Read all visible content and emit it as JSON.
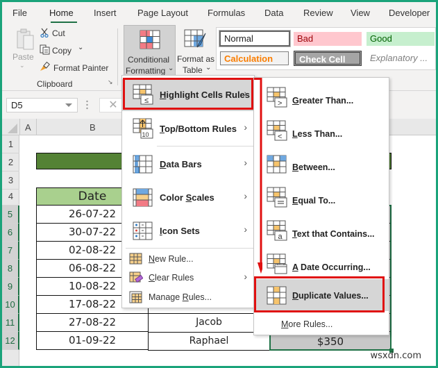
{
  "ribbon_tabs": [
    "File",
    "Home",
    "Insert",
    "Page Layout",
    "Formulas",
    "Data",
    "Review",
    "View",
    "Developer"
  ],
  "active_tab": "Home",
  "clipboard": {
    "paste_label": "Paste",
    "cut_label": "Cut",
    "copy_label": "Copy",
    "format_painter_label": "Format Painter",
    "group_label": "Clipboard"
  },
  "styles": {
    "conditional_formatting_line1": "Conditional",
    "conditional_formatting_line2": "Formatting",
    "format_as_table_line1": "Format as",
    "format_as_table_line2": "Table",
    "cell_styles": [
      {
        "label": "Normal",
        "color": "#222222",
        "bg": "#ffffff"
      },
      {
        "label": "Bad",
        "color": "#9c0006",
        "bg": "#ffc7ce"
      },
      {
        "label": "Good",
        "color": "#006100",
        "bg": "#c6efce"
      },
      {
        "label": "Calculation",
        "color": "#fa7d00",
        "bg": "#f2f2f2"
      },
      {
        "label": "Check Cell",
        "color": "#ffffff",
        "bg": "#a5a5a5"
      },
      {
        "label": "Explanatory ...",
        "color": "#7f7f7f",
        "bg": "#ffffff"
      }
    ]
  },
  "formula_bar": {
    "name_box": "D5",
    "cancel_symbol": "✕"
  },
  "columns": [
    "A",
    "B"
  ],
  "rows": [
    "1",
    "2",
    "3",
    "4",
    "5",
    "6",
    "7",
    "8",
    "9",
    "10",
    "11",
    "12"
  ],
  "sheet": {
    "date_header": "Date",
    "dates": [
      "26-07-22",
      "30-07-22",
      "02-08-22",
      "06-08-22",
      "10-08-22",
      "17-08-22",
      "27-08-22",
      "01-09-22"
    ],
    "names_visible": [
      "Jacob",
      "Raphael"
    ],
    "amount_visible": "$350"
  },
  "cf_menu": {
    "items": [
      {
        "label": "Highlight Cells Rules",
        "underline": "H",
        "icon": "highlight-cells-icon",
        "submenu": true
      },
      {
        "label": "Top/Bottom Rules",
        "underline": "T",
        "icon": "top-bottom-icon",
        "submenu": true
      },
      {
        "label": "Data Bars",
        "underline": "D",
        "icon": "data-bars-icon",
        "submenu": true
      },
      {
        "label": "Color Scales",
        "underline": "S",
        "icon": "color-scales-icon",
        "submenu": true
      },
      {
        "label": "Icon Sets",
        "underline": "I",
        "icon": "icon-sets-icon",
        "submenu": true
      }
    ],
    "small_items": [
      {
        "label": "New Rule...",
        "icon": "new-rule-icon",
        "submenu": false
      },
      {
        "label": "Clear Rules",
        "icon": "clear-rules-icon",
        "submenu": true
      },
      {
        "label": "Manage Rules...",
        "icon": "manage-rules-icon",
        "submenu": false
      }
    ]
  },
  "highlight_submenu": {
    "items": [
      {
        "label": "Greater Than...",
        "icon": "greater-than-icon"
      },
      {
        "label": "Less Than...",
        "icon": "less-than-icon"
      },
      {
        "label": "Between...",
        "icon": "between-icon"
      },
      {
        "label": "Equal To...",
        "icon": "equal-to-icon"
      },
      {
        "label": "Text that Contains...",
        "icon": "text-contains-icon"
      },
      {
        "label": "A Date Occurring...",
        "icon": "date-occurring-icon"
      },
      {
        "label": "Duplicate Values...",
        "icon": "duplicate-values-icon"
      }
    ],
    "more_rules": "More Rules..."
  },
  "watermark": "wsxdn.com",
  "accent_colors": {
    "excel_green": "#1e7145",
    "annotation_red": "#e01010",
    "header_green": "#a9d08e",
    "title_bar_green": "#548235"
  }
}
